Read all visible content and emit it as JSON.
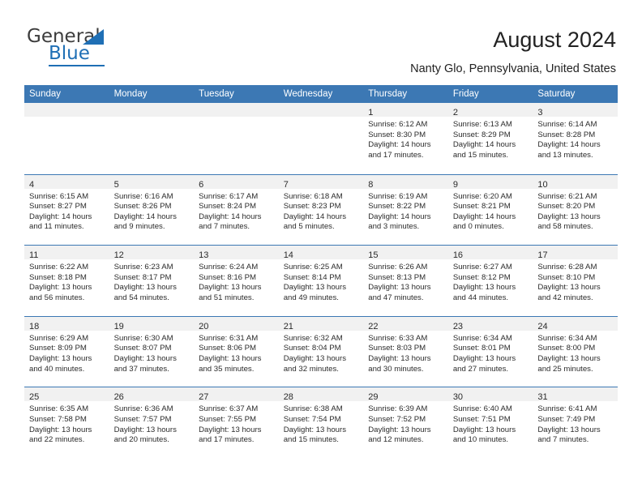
{
  "brand": {
    "name_top": "General",
    "name_bottom": "Blue",
    "triangle_color": "#1f6fb5"
  },
  "header": {
    "title": "August 2024",
    "location": "Nanty Glo, Pennsylvania, United States"
  },
  "theme": {
    "header_blue": "#3c78b4",
    "day_strip_gray": "#f1f1f1",
    "text": "#2b2b2b"
  },
  "calendar": {
    "weekdays": [
      "Sunday",
      "Monday",
      "Tuesday",
      "Wednesday",
      "Thursday",
      "Friday",
      "Saturday"
    ],
    "weeks": [
      [
        {
          "day": "",
          "sunrise": "",
          "sunset": "",
          "daylight": "",
          "daylight2": ""
        },
        {
          "day": "",
          "sunrise": "",
          "sunset": "",
          "daylight": "",
          "daylight2": ""
        },
        {
          "day": "",
          "sunrise": "",
          "sunset": "",
          "daylight": "",
          "daylight2": ""
        },
        {
          "day": "",
          "sunrise": "",
          "sunset": "",
          "daylight": "",
          "daylight2": ""
        },
        {
          "day": "1",
          "sunrise": "Sunrise: 6:12 AM",
          "sunset": "Sunset: 8:30 PM",
          "daylight": "Daylight: 14 hours",
          "daylight2": "and 17 minutes."
        },
        {
          "day": "2",
          "sunrise": "Sunrise: 6:13 AM",
          "sunset": "Sunset: 8:29 PM",
          "daylight": "Daylight: 14 hours",
          "daylight2": "and 15 minutes."
        },
        {
          "day": "3",
          "sunrise": "Sunrise: 6:14 AM",
          "sunset": "Sunset: 8:28 PM",
          "daylight": "Daylight: 14 hours",
          "daylight2": "and 13 minutes."
        }
      ],
      [
        {
          "day": "4",
          "sunrise": "Sunrise: 6:15 AM",
          "sunset": "Sunset: 8:27 PM",
          "daylight": "Daylight: 14 hours",
          "daylight2": "and 11 minutes."
        },
        {
          "day": "5",
          "sunrise": "Sunrise: 6:16 AM",
          "sunset": "Sunset: 8:26 PM",
          "daylight": "Daylight: 14 hours",
          "daylight2": "and 9 minutes."
        },
        {
          "day": "6",
          "sunrise": "Sunrise: 6:17 AM",
          "sunset": "Sunset: 8:24 PM",
          "daylight": "Daylight: 14 hours",
          "daylight2": "and 7 minutes."
        },
        {
          "day": "7",
          "sunrise": "Sunrise: 6:18 AM",
          "sunset": "Sunset: 8:23 PM",
          "daylight": "Daylight: 14 hours",
          "daylight2": "and 5 minutes."
        },
        {
          "day": "8",
          "sunrise": "Sunrise: 6:19 AM",
          "sunset": "Sunset: 8:22 PM",
          "daylight": "Daylight: 14 hours",
          "daylight2": "and 3 minutes."
        },
        {
          "day": "9",
          "sunrise": "Sunrise: 6:20 AM",
          "sunset": "Sunset: 8:21 PM",
          "daylight": "Daylight: 14 hours",
          "daylight2": "and 0 minutes."
        },
        {
          "day": "10",
          "sunrise": "Sunrise: 6:21 AM",
          "sunset": "Sunset: 8:20 PM",
          "daylight": "Daylight: 13 hours",
          "daylight2": "and 58 minutes."
        }
      ],
      [
        {
          "day": "11",
          "sunrise": "Sunrise: 6:22 AM",
          "sunset": "Sunset: 8:18 PM",
          "daylight": "Daylight: 13 hours",
          "daylight2": "and 56 minutes."
        },
        {
          "day": "12",
          "sunrise": "Sunrise: 6:23 AM",
          "sunset": "Sunset: 8:17 PM",
          "daylight": "Daylight: 13 hours",
          "daylight2": "and 54 minutes."
        },
        {
          "day": "13",
          "sunrise": "Sunrise: 6:24 AM",
          "sunset": "Sunset: 8:16 PM",
          "daylight": "Daylight: 13 hours",
          "daylight2": "and 51 minutes."
        },
        {
          "day": "14",
          "sunrise": "Sunrise: 6:25 AM",
          "sunset": "Sunset: 8:14 PM",
          "daylight": "Daylight: 13 hours",
          "daylight2": "and 49 minutes."
        },
        {
          "day": "15",
          "sunrise": "Sunrise: 6:26 AM",
          "sunset": "Sunset: 8:13 PM",
          "daylight": "Daylight: 13 hours",
          "daylight2": "and 47 minutes."
        },
        {
          "day": "16",
          "sunrise": "Sunrise: 6:27 AM",
          "sunset": "Sunset: 8:12 PM",
          "daylight": "Daylight: 13 hours",
          "daylight2": "and 44 minutes."
        },
        {
          "day": "17",
          "sunrise": "Sunrise: 6:28 AM",
          "sunset": "Sunset: 8:10 PM",
          "daylight": "Daylight: 13 hours",
          "daylight2": "and 42 minutes."
        }
      ],
      [
        {
          "day": "18",
          "sunrise": "Sunrise: 6:29 AM",
          "sunset": "Sunset: 8:09 PM",
          "daylight": "Daylight: 13 hours",
          "daylight2": "and 40 minutes."
        },
        {
          "day": "19",
          "sunrise": "Sunrise: 6:30 AM",
          "sunset": "Sunset: 8:07 PM",
          "daylight": "Daylight: 13 hours",
          "daylight2": "and 37 minutes."
        },
        {
          "day": "20",
          "sunrise": "Sunrise: 6:31 AM",
          "sunset": "Sunset: 8:06 PM",
          "daylight": "Daylight: 13 hours",
          "daylight2": "and 35 minutes."
        },
        {
          "day": "21",
          "sunrise": "Sunrise: 6:32 AM",
          "sunset": "Sunset: 8:04 PM",
          "daylight": "Daylight: 13 hours",
          "daylight2": "and 32 minutes."
        },
        {
          "day": "22",
          "sunrise": "Sunrise: 6:33 AM",
          "sunset": "Sunset: 8:03 PM",
          "daylight": "Daylight: 13 hours",
          "daylight2": "and 30 minutes."
        },
        {
          "day": "23",
          "sunrise": "Sunrise: 6:34 AM",
          "sunset": "Sunset: 8:01 PM",
          "daylight": "Daylight: 13 hours",
          "daylight2": "and 27 minutes."
        },
        {
          "day": "24",
          "sunrise": "Sunrise: 6:34 AM",
          "sunset": "Sunset: 8:00 PM",
          "daylight": "Daylight: 13 hours",
          "daylight2": "and 25 minutes."
        }
      ],
      [
        {
          "day": "25",
          "sunrise": "Sunrise: 6:35 AM",
          "sunset": "Sunset: 7:58 PM",
          "daylight": "Daylight: 13 hours",
          "daylight2": "and 22 minutes."
        },
        {
          "day": "26",
          "sunrise": "Sunrise: 6:36 AM",
          "sunset": "Sunset: 7:57 PM",
          "daylight": "Daylight: 13 hours",
          "daylight2": "and 20 minutes."
        },
        {
          "day": "27",
          "sunrise": "Sunrise: 6:37 AM",
          "sunset": "Sunset: 7:55 PM",
          "daylight": "Daylight: 13 hours",
          "daylight2": "and 17 minutes."
        },
        {
          "day": "28",
          "sunrise": "Sunrise: 6:38 AM",
          "sunset": "Sunset: 7:54 PM",
          "daylight": "Daylight: 13 hours",
          "daylight2": "and 15 minutes."
        },
        {
          "day": "29",
          "sunrise": "Sunrise: 6:39 AM",
          "sunset": "Sunset: 7:52 PM",
          "daylight": "Daylight: 13 hours",
          "daylight2": "and 12 minutes."
        },
        {
          "day": "30",
          "sunrise": "Sunrise: 6:40 AM",
          "sunset": "Sunset: 7:51 PM",
          "daylight": "Daylight: 13 hours",
          "daylight2": "and 10 minutes."
        },
        {
          "day": "31",
          "sunrise": "Sunrise: 6:41 AM",
          "sunset": "Sunset: 7:49 PM",
          "daylight": "Daylight: 13 hours",
          "daylight2": "and 7 minutes."
        }
      ]
    ]
  }
}
